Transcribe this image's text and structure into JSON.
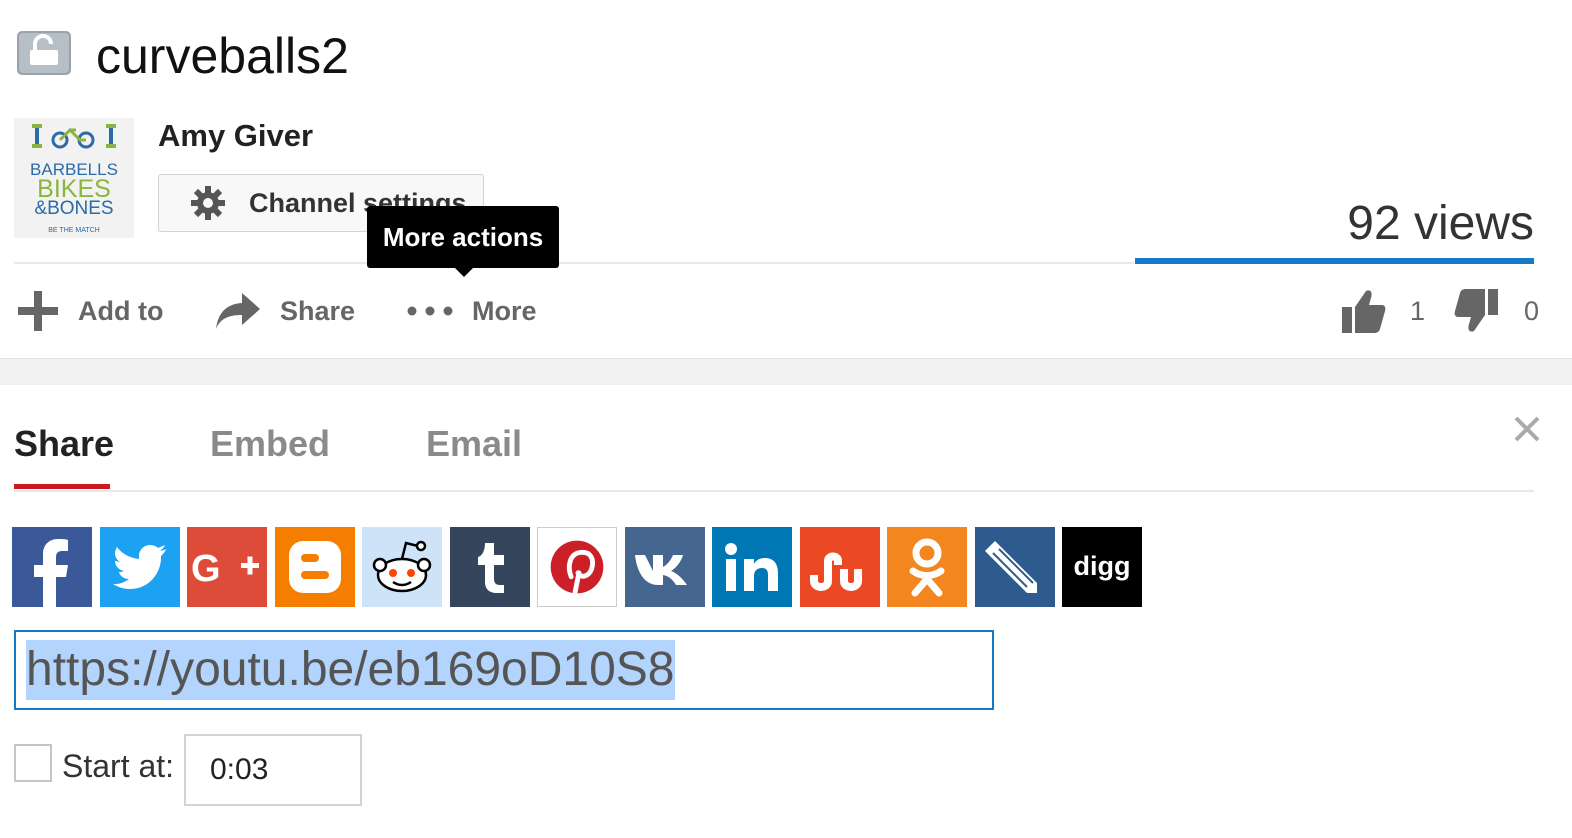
{
  "video": {
    "title": "curveballs2",
    "privacy_icon": "unlisted-lock-icon",
    "views": "92 views"
  },
  "channel": {
    "name": "Amy Giver",
    "logo_lines": [
      "BARBELLS",
      "BIKES",
      "&BONES",
      "BE THE MATCH"
    ],
    "settings_label": "Channel settings"
  },
  "actions": {
    "add_to": "Add to",
    "share": "Share",
    "more": "More",
    "tooltip": "More actions",
    "likes": "1",
    "dislikes": "0"
  },
  "share_panel": {
    "tabs": [
      "Share",
      "Embed",
      "Email"
    ],
    "active_tab": "Share",
    "social": [
      {
        "name": "facebook",
        "color": "#3b5998"
      },
      {
        "name": "twitter",
        "color": "#1da1f2"
      },
      {
        "name": "google-plus",
        "color": "#dd4b39"
      },
      {
        "name": "blogger",
        "color": "#f57d00"
      },
      {
        "name": "reddit",
        "color": "#cee3f8"
      },
      {
        "name": "tumblr",
        "color": "#35465c"
      },
      {
        "name": "pinterest",
        "color": "#ffffff"
      },
      {
        "name": "vk",
        "color": "#45668e"
      },
      {
        "name": "linkedin",
        "color": "#0077b5"
      },
      {
        "name": "stumbleupon",
        "color": "#eb4924"
      },
      {
        "name": "odnoklassniki",
        "color": "#f4861f"
      },
      {
        "name": "livejournal",
        "color": "#2d5b8f"
      },
      {
        "name": "digg",
        "color": "#000000"
      }
    ],
    "url": "https://youtu.be/eb169oD10S8",
    "start_at_label": "Start at:",
    "start_at_value": "0:03"
  },
  "colors": {
    "accent_blue": "#167ac6",
    "active_tab_red": "#cc181e",
    "logo_green": "#8cb440",
    "logo_blue": "#2c6aa8"
  }
}
